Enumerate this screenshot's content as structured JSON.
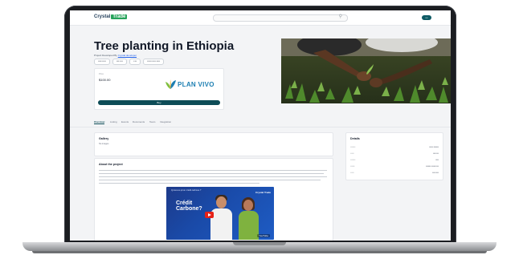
{
  "navbar": {
    "logo_word": "Crystal",
    "logo_badge": "Trade",
    "search_icon": "search-icon",
    "login_label": "•••"
  },
  "hero": {
    "title": "Tree planting in Ethiopia",
    "subtitle_prefix": "Project Developed By",
    "subtitle_link": "Crystal developer",
    "tags": [
      "••••• •••••",
      "•••• ••••",
      "• •••",
      "•••••• ••••• •••••"
    ],
    "price_label": "Price",
    "price_value": "$100.00",
    "standard_logo_text": "PLAN VIVO",
    "buy_label": "Buy"
  },
  "tabs": [
    "Overview",
    "Listing",
    "Events",
    "Documents",
    "Team",
    "Integration"
  ],
  "active_tab": 0,
  "gallery_panel": {
    "title": "Gallery",
    "empty_text": "No images"
  },
  "about_panel": {
    "title": "About the project",
    "video_header": "Qu'est-ce qu'un crédit carbone ?",
    "video_title": "Crédit\nCarbone?",
    "video_brand": "Crystal Trade",
    "video_yt_label": "YouTube"
  },
  "details_panel": {
    "title": "Details",
    "rows": [
      {
        "key": "•••••••",
        "value": "••••• •••••••"
      },
      {
        "key": "•••••",
        "value": "•••• •••"
      },
      {
        "key": "•••••••",
        "value": "••••"
      },
      {
        "key": "••••••",
        "value": "••••••• •••••• •••"
      },
      {
        "key": "•••••",
        "value": "•••• ••••"
      }
    ]
  },
  "colors": {
    "brand_green": "#27a35a",
    "primary_teal": "#0d4c57",
    "link_blue": "#2563eb",
    "planvivo_blue": "#1d7fb2"
  }
}
